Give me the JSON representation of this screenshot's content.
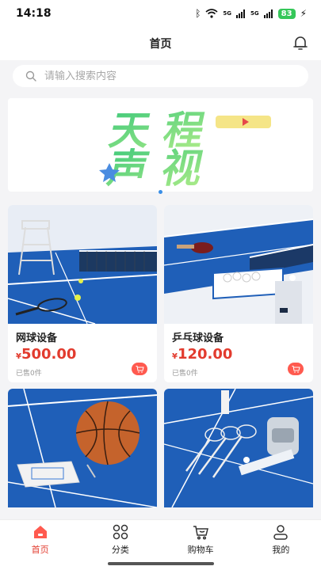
{
  "status": {
    "time": "14:18",
    "battery": "83",
    "net1": "5G",
    "net2": "5G"
  },
  "nav": {
    "title": "首页"
  },
  "search": {
    "placeholder": "请输入搜索内容"
  },
  "banner": {
    "line1": "天程",
    "line2": "声视"
  },
  "products": [
    {
      "title": "网球设备",
      "currency": "¥",
      "price": "500.00",
      "sold": "已售0件"
    },
    {
      "title": "乒乓球设备",
      "currency": "¥",
      "price": "120.00",
      "sold": "已售0件"
    }
  ],
  "tabs": [
    {
      "label": "首页",
      "icon": "home-icon"
    },
    {
      "label": "分类",
      "icon": "grid-icon"
    },
    {
      "label": "购物车",
      "icon": "cart-icon"
    },
    {
      "label": "我的",
      "icon": "user-icon"
    }
  ],
  "colors": {
    "accent": "#e23b2e",
    "banner_green": "#5cd18a",
    "court_blue": "#1f5fb8"
  }
}
